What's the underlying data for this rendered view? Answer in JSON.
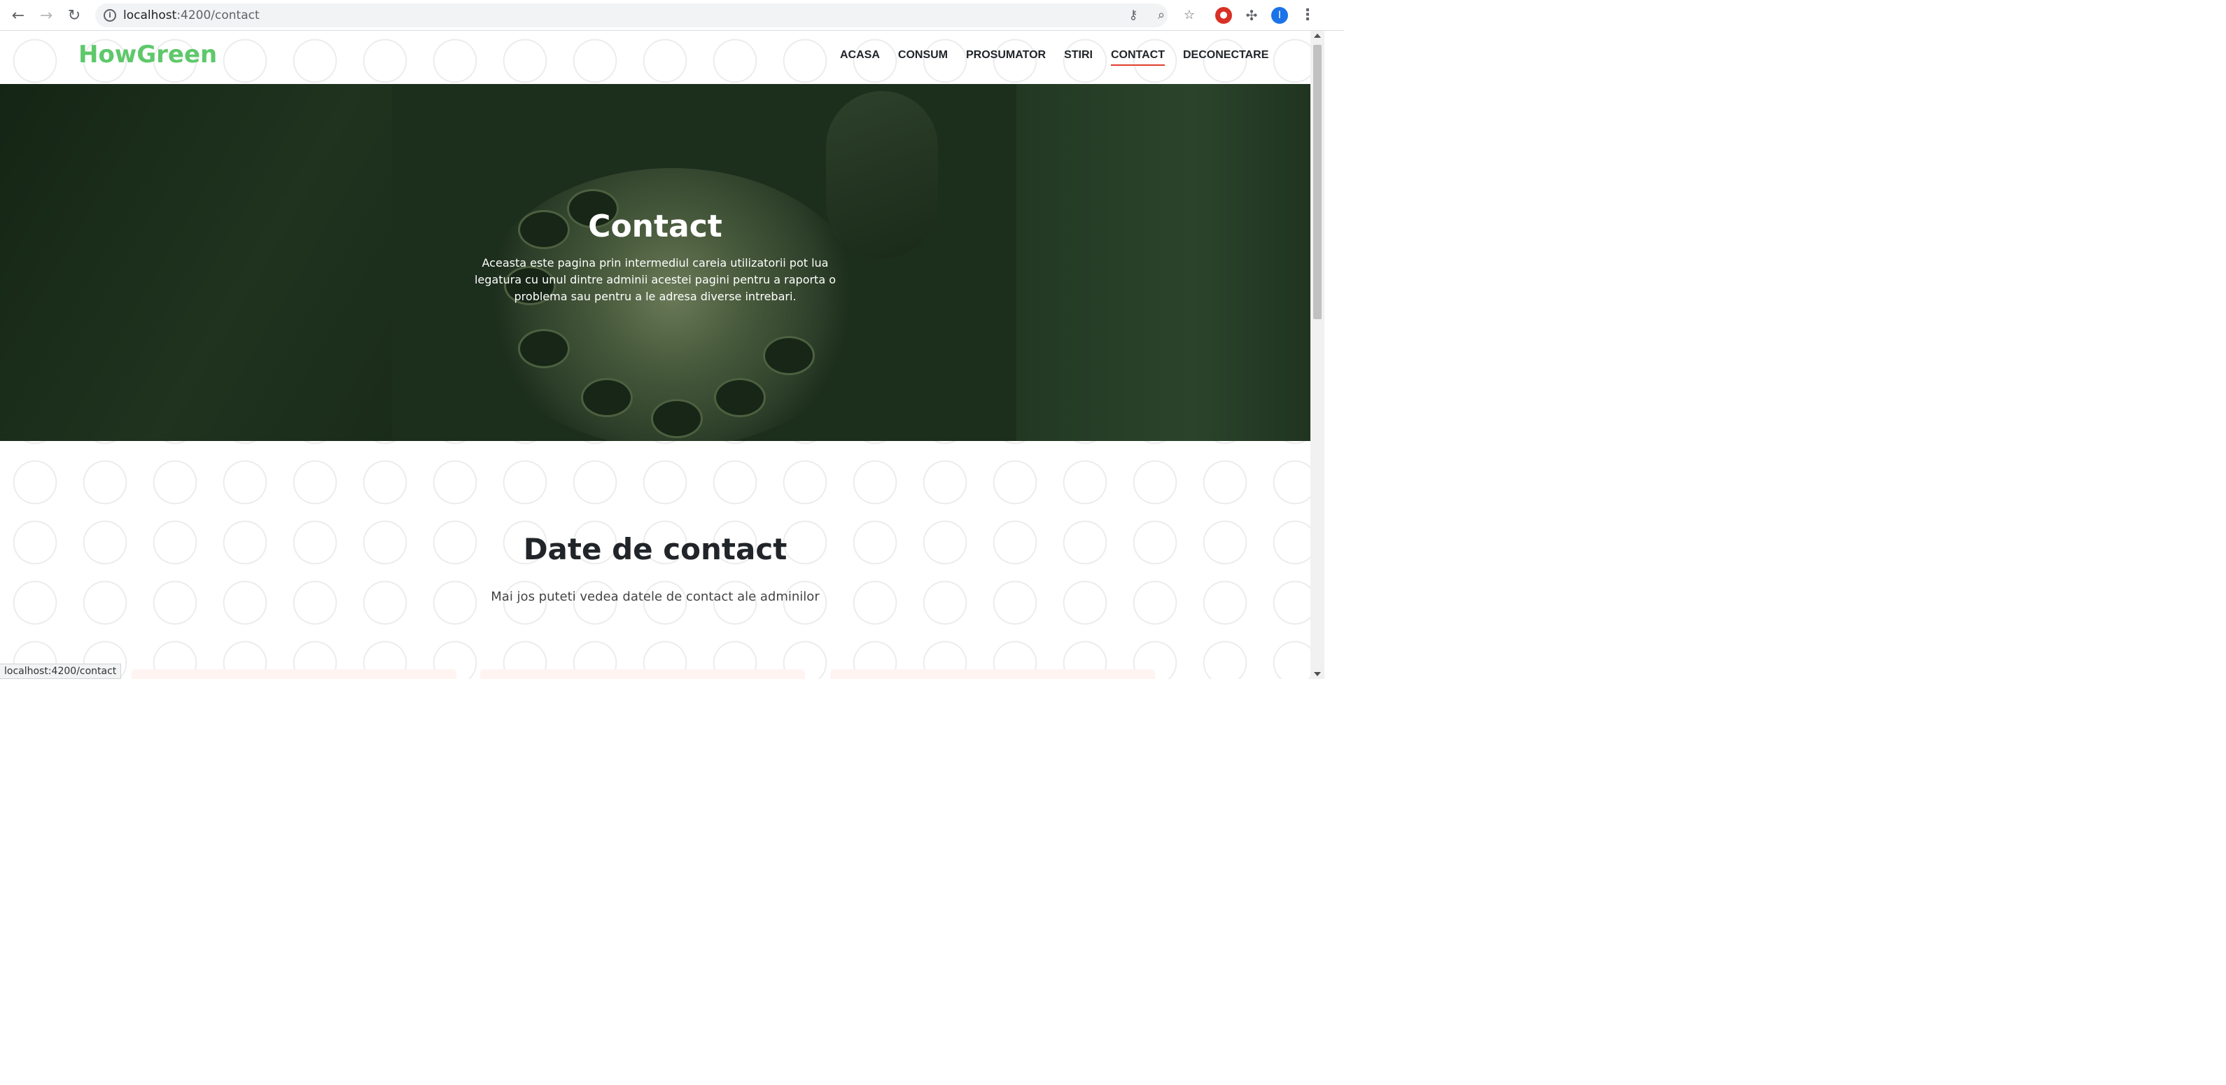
{
  "browser": {
    "url_host": "localhost",
    "url_path": ":4200/contact",
    "status_text": "localhost:4200/contact",
    "profile_initial": "I"
  },
  "site": {
    "logo": "HowGreen",
    "menu": [
      {
        "label": "ACASA",
        "active": false
      },
      {
        "label": "CONSUM",
        "active": false
      },
      {
        "label": "PROSUMATOR",
        "active": false
      },
      {
        "label": "STIRI",
        "active": false
      },
      {
        "label": "CONTACT",
        "active": true
      },
      {
        "label": "DECONECTARE",
        "active": false
      }
    ],
    "active_color": "#e03e2d",
    "logo_color": "#5ec86b"
  },
  "hero": {
    "title": "Contact",
    "text": "Aceasta este pagina prin intermediul careia utilizatorii pot lua legatura cu unul dintre adminii acestei pagini pentru a raporta o problema sau pentru a le adresa diverse intrebari."
  },
  "section": {
    "title": "Date de contact",
    "subtitle": "Mai jos puteti vedea datele de contact ale adminilor"
  },
  "icons": {
    "back": "arrow-left-icon",
    "forward": "arrow-right-icon",
    "reload": "reload-icon",
    "info": "info-icon",
    "key": "key-icon",
    "zoom": "zoom-icon",
    "star": "star-icon",
    "extension": "puzzle-icon",
    "menu": "kebab-menu-icon"
  }
}
